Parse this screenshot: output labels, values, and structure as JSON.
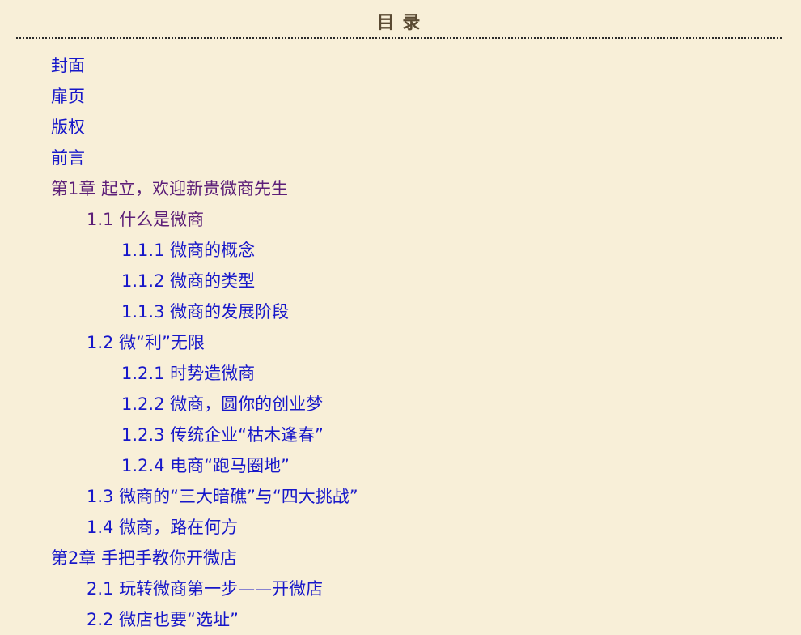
{
  "toc": {
    "title": "目  录",
    "items": [
      {
        "label": "封面",
        "level": 0,
        "visited": false
      },
      {
        "label": "扉页",
        "level": 0,
        "visited": false
      },
      {
        "label": "版权",
        "level": 0,
        "visited": false
      },
      {
        "label": "前言",
        "level": 0,
        "visited": false
      },
      {
        "label": "第1章 起立，欢迎新贵微商先生",
        "level": 0,
        "visited": true
      },
      {
        "label": "1.1 什么是微商",
        "level": 1,
        "visited": true
      },
      {
        "label": "1.1.1 微商的概念",
        "level": 2,
        "visited": false
      },
      {
        "label": "1.1.2 微商的类型",
        "level": 2,
        "visited": false
      },
      {
        "label": "1.1.3 微商的发展阶段",
        "level": 2,
        "visited": false
      },
      {
        "label": "1.2 微“利”无限",
        "level": 1,
        "visited": false
      },
      {
        "label": "1.2.1 时势造微商",
        "level": 2,
        "visited": false
      },
      {
        "label": "1.2.2 微商，圆你的创业梦",
        "level": 2,
        "visited": false
      },
      {
        "label": "1.2.3 传统企业“枯木逢春”",
        "level": 2,
        "visited": false
      },
      {
        "label": "1.2.4 电商“跑马圈地”",
        "level": 2,
        "visited": false
      },
      {
        "label": "1.3 微商的“三大暗礁”与“四大挑战”",
        "level": 1,
        "visited": false
      },
      {
        "label": "1.4 微商，路在何方",
        "level": 1,
        "visited": false
      },
      {
        "label": "第2章 手把手教你开微店",
        "level": 0,
        "visited": false
      },
      {
        "label": "2.1 玩转微商第一步——开微店",
        "level": 1,
        "visited": false
      },
      {
        "label": "2.2 微店也要“选址”",
        "level": 1,
        "visited": false
      }
    ]
  },
  "colors": {
    "background": "#f8efd8",
    "link": "#1717c9",
    "visited_link": "#5d1f78",
    "title": "#5a4a33"
  }
}
